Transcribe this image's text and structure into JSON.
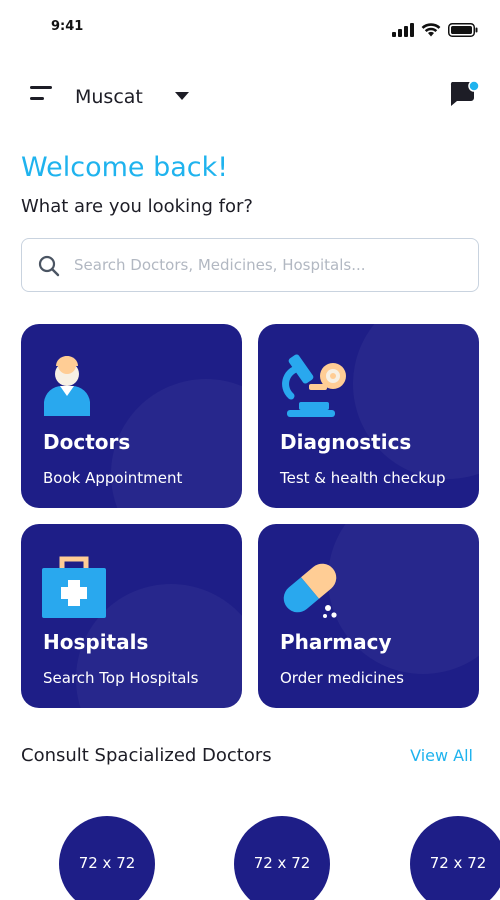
{
  "status_bar": {
    "time": "9:41"
  },
  "header": {
    "city": "Muscat"
  },
  "welcome": {
    "title": "Welcome back!",
    "subtitle": "What are you looking for?"
  },
  "search": {
    "placeholder": "Search Doctors, Medicines, Hospitals..."
  },
  "categories": [
    {
      "title": "Doctors",
      "subtitle": "Book Appointment",
      "icon": "doctor-icon"
    },
    {
      "title": "Diagnostics",
      "subtitle": "Test & health checkup",
      "icon": "microscope-icon"
    },
    {
      "title": "Hospitals",
      "subtitle": "Search Top Hospitals",
      "icon": "first-aid-kit-icon"
    },
    {
      "title": "Pharmacy",
      "subtitle": "Order medicines",
      "icon": "pill-icon"
    }
  ],
  "specialized": {
    "title": "Consult Spacialized Doctors",
    "view_all": "View All",
    "doctors": [
      {
        "label": "72 x 72"
      },
      {
        "label": "72 x 72"
      },
      {
        "label": "72 x 72"
      }
    ]
  },
  "colors": {
    "accent": "#1fb3ee",
    "card_bg": "#1e1e87",
    "notification_dot": "#1fb3ee"
  }
}
